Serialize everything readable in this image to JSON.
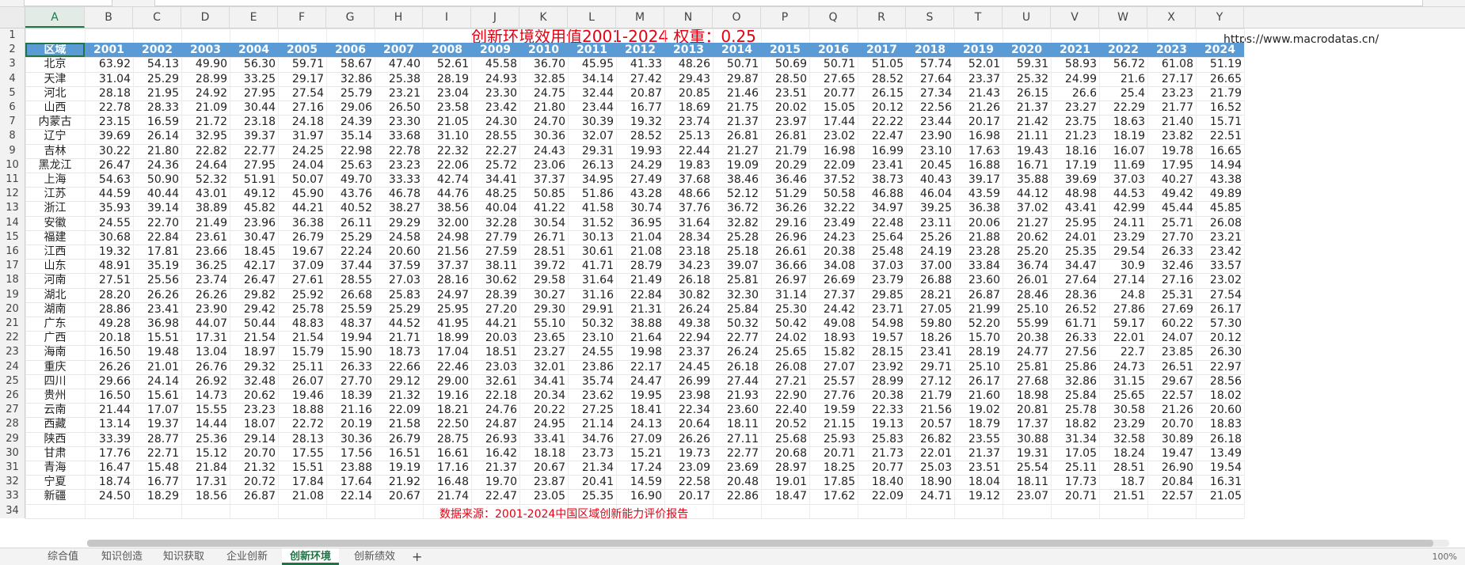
{
  "name_box": "A2",
  "formula_bar": "区域",
  "title": "创新环境效用值2001-2024    权重：0.25",
  "url": "https://www.macrodatas.cn/",
  "footer_note": "数据来源：2001-2024中国区域创新能力评价报告",
  "columns": [
    "A",
    "B",
    "C",
    "D",
    "E",
    "F",
    "G",
    "H",
    "I",
    "J",
    "K",
    "L",
    "M",
    "N",
    "O",
    "P",
    "Q",
    "R",
    "S",
    "T",
    "U",
    "V",
    "W",
    "X",
    "Y"
  ],
  "header_row": [
    "区域",
    "2001",
    "2002",
    "2003",
    "2004",
    "2005",
    "2006",
    "2007",
    "2008",
    "2009",
    "2010",
    "2011",
    "2012",
    "2013",
    "2014",
    "2015",
    "2016",
    "2017",
    "2018",
    "2019",
    "2020",
    "2021",
    "2022",
    "2023",
    "2024"
  ],
  "rows": [
    [
      "北京",
      "63.92",
      "54.13",
      "49.90",
      "56.30",
      "59.71",
      "58.67",
      "47.40",
      "52.61",
      "45.58",
      "36.70",
      "45.95",
      "41.33",
      "48.26",
      "50.71",
      "50.69",
      "50.71",
      "51.05",
      "57.74",
      "52.01",
      "59.31",
      "58.93",
      "56.72",
      "61.08",
      "51.19"
    ],
    [
      "天津",
      "31.04",
      "25.29",
      "28.99",
      "33.25",
      "29.17",
      "32.86",
      "25.38",
      "28.19",
      "24.93",
      "32.85",
      "34.14",
      "27.42",
      "29.43",
      "29.87",
      "28.50",
      "27.65",
      "28.52",
      "27.64",
      "23.37",
      "25.32",
      "24.99",
      "21.6",
      "27.17",
      "26.65"
    ],
    [
      "河北",
      "28.18",
      "21.95",
      "24.92",
      "27.95",
      "27.54",
      "25.79",
      "23.21",
      "23.04",
      "23.30",
      "24.75",
      "32.44",
      "20.87",
      "20.85",
      "21.46",
      "23.51",
      "20.77",
      "26.15",
      "27.34",
      "21.43",
      "26.15",
      "26.6",
      "25.4",
      "23.23",
      "21.79"
    ],
    [
      "山西",
      "22.78",
      "28.33",
      "21.09",
      "30.44",
      "27.16",
      "29.06",
      "26.50",
      "23.58",
      "23.42",
      "21.80",
      "23.44",
      "16.77",
      "18.69",
      "21.75",
      "20.02",
      "15.05",
      "20.12",
      "22.56",
      "21.26",
      "21.37",
      "23.27",
      "22.29",
      "21.77",
      "16.52"
    ],
    [
      "内蒙古",
      "23.15",
      "16.59",
      "21.72",
      "23.18",
      "24.18",
      "24.39",
      "23.30",
      "21.05",
      "24.30",
      "24.70",
      "30.39",
      "19.32",
      "23.74",
      "21.37",
      "23.97",
      "17.44",
      "22.22",
      "23.44",
      "20.17",
      "21.42",
      "23.75",
      "18.63",
      "21.40",
      "15.71"
    ],
    [
      "辽宁",
      "39.69",
      "26.14",
      "32.95",
      "39.37",
      "31.97",
      "35.14",
      "33.68",
      "31.10",
      "28.55",
      "30.36",
      "32.07",
      "28.52",
      "25.13",
      "26.81",
      "26.81",
      "23.02",
      "22.47",
      "23.90",
      "16.98",
      "21.11",
      "21.23",
      "18.19",
      "23.82",
      "22.51"
    ],
    [
      "吉林",
      "30.22",
      "21.80",
      "22.82",
      "22.77",
      "24.25",
      "22.98",
      "22.78",
      "22.32",
      "22.27",
      "24.43",
      "29.31",
      "19.93",
      "22.44",
      "21.27",
      "21.79",
      "16.98",
      "16.99",
      "23.10",
      "17.63",
      "19.43",
      "18.16",
      "16.07",
      "19.78",
      "16.65"
    ],
    [
      "黑龙江",
      "26.47",
      "24.36",
      "24.64",
      "27.95",
      "24.04",
      "25.63",
      "23.23",
      "22.06",
      "25.72",
      "23.06",
      "26.13",
      "24.29",
      "19.83",
      "19.09",
      "20.29",
      "22.09",
      "23.41",
      "20.45",
      "16.88",
      "16.71",
      "17.19",
      "11.69",
      "17.95",
      "14.94"
    ],
    [
      "上海",
      "54.63",
      "50.90",
      "52.32",
      "51.91",
      "50.07",
      "49.70",
      "33.33",
      "42.74",
      "34.41",
      "37.37",
      "34.95",
      "27.49",
      "37.68",
      "38.46",
      "36.46",
      "37.52",
      "38.73",
      "40.43",
      "39.17",
      "35.88",
      "39.69",
      "37.03",
      "40.27",
      "43.38"
    ],
    [
      "江苏",
      "44.59",
      "40.44",
      "43.01",
      "49.12",
      "45.90",
      "43.76",
      "46.78",
      "44.76",
      "48.25",
      "50.85",
      "51.86",
      "43.28",
      "48.66",
      "52.12",
      "51.29",
      "50.58",
      "46.88",
      "46.04",
      "43.59",
      "44.12",
      "48.98",
      "44.53",
      "49.42",
      "49.89"
    ],
    [
      "浙江",
      "35.93",
      "39.14",
      "38.89",
      "45.82",
      "44.21",
      "40.52",
      "38.27",
      "38.56",
      "40.04",
      "41.22",
      "41.58",
      "30.74",
      "37.76",
      "36.72",
      "36.26",
      "32.22",
      "34.97",
      "39.25",
      "36.38",
      "37.02",
      "43.41",
      "42.99",
      "45.44",
      "45.85"
    ],
    [
      "安徽",
      "24.55",
      "22.70",
      "21.49",
      "23.96",
      "36.38",
      "26.11",
      "29.29",
      "32.00",
      "32.28",
      "30.54",
      "31.52",
      "36.95",
      "31.64",
      "32.82",
      "29.16",
      "23.49",
      "22.48",
      "23.11",
      "20.06",
      "21.27",
      "25.95",
      "24.11",
      "25.71",
      "26.08"
    ],
    [
      "福建",
      "30.68",
      "22.84",
      "23.61",
      "30.47",
      "26.79",
      "25.29",
      "24.58",
      "24.98",
      "27.79",
      "26.71",
      "30.13",
      "21.04",
      "28.34",
      "25.28",
      "26.96",
      "24.23",
      "25.64",
      "25.26",
      "21.88",
      "20.62",
      "24.01",
      "23.29",
      "27.70",
      "23.21"
    ],
    [
      "江西",
      "19.32",
      "17.81",
      "23.66",
      "18.45",
      "19.67",
      "22.24",
      "20.60",
      "21.56",
      "27.59",
      "28.51",
      "30.61",
      "21.08",
      "23.18",
      "25.18",
      "26.61",
      "20.38",
      "25.48",
      "24.19",
      "23.28",
      "25.20",
      "25.35",
      "29.54",
      "26.33",
      "23.42"
    ],
    [
      "山东",
      "48.91",
      "35.19",
      "36.25",
      "42.17",
      "37.09",
      "37.44",
      "37.59",
      "37.37",
      "38.11",
      "39.72",
      "41.71",
      "28.79",
      "34.23",
      "39.07",
      "36.66",
      "34.08",
      "37.03",
      "37.00",
      "33.84",
      "36.74",
      "34.47",
      "30.9",
      "32.46",
      "33.57"
    ],
    [
      "河南",
      "27.51",
      "25.56",
      "23.74",
      "26.47",
      "27.61",
      "28.55",
      "27.03",
      "28.16",
      "30.62",
      "29.58",
      "31.64",
      "21.49",
      "26.18",
      "25.81",
      "26.97",
      "26.69",
      "23.79",
      "26.88",
      "23.60",
      "26.01",
      "27.64",
      "27.14",
      "27.16",
      "23.02"
    ],
    [
      "湖北",
      "28.20",
      "26.26",
      "26.26",
      "29.82",
      "25.92",
      "26.68",
      "25.83",
      "24.97",
      "28.39",
      "30.27",
      "31.16",
      "22.84",
      "30.82",
      "32.30",
      "31.14",
      "27.37",
      "29.85",
      "28.21",
      "26.87",
      "28.46",
      "28.36",
      "24.8",
      "25.31",
      "27.54"
    ],
    [
      "湖南",
      "28.86",
      "23.41",
      "23.90",
      "29.42",
      "25.78",
      "25.59",
      "25.29",
      "25.95",
      "27.20",
      "29.30",
      "29.91",
      "21.31",
      "26.24",
      "25.84",
      "25.30",
      "24.42",
      "23.71",
      "27.05",
      "21.99",
      "25.10",
      "26.52",
      "27.86",
      "27.69",
      "26.17"
    ],
    [
      "广东",
      "49.28",
      "36.98",
      "44.07",
      "50.44",
      "48.83",
      "48.37",
      "44.52",
      "41.95",
      "44.21",
      "55.10",
      "50.32",
      "38.88",
      "49.38",
      "50.32",
      "50.42",
      "49.08",
      "54.98",
      "59.80",
      "52.20",
      "55.99",
      "61.71",
      "59.17",
      "60.22",
      "57.30"
    ],
    [
      "广西",
      "20.18",
      "15.51",
      "17.31",
      "21.54",
      "21.54",
      "19.94",
      "21.71",
      "18.99",
      "20.03",
      "23.65",
      "23.10",
      "21.64",
      "22.94",
      "22.77",
      "24.02",
      "18.93",
      "19.57",
      "18.26",
      "15.70",
      "20.38",
      "26.33",
      "22.01",
      "24.07",
      "20.12"
    ],
    [
      "海南",
      "16.50",
      "19.48",
      "13.04",
      "18.97",
      "15.79",
      "15.90",
      "18.73",
      "17.04",
      "18.51",
      "23.27",
      "24.55",
      "19.98",
      "23.37",
      "26.24",
      "25.65",
      "15.82",
      "28.15",
      "23.41",
      "28.19",
      "24.77",
      "27.56",
      "22.7",
      "23.85",
      "26.30"
    ],
    [
      "重庆",
      "26.26",
      "21.01",
      "26.76",
      "29.32",
      "25.11",
      "26.33",
      "22.66",
      "22.46",
      "23.03",
      "32.01",
      "23.86",
      "22.17",
      "24.45",
      "26.18",
      "26.08",
      "27.07",
      "23.92",
      "29.71",
      "25.10",
      "25.81",
      "25.86",
      "24.73",
      "26.51",
      "22.97"
    ],
    [
      "四川",
      "29.66",
      "24.14",
      "26.92",
      "32.48",
      "26.07",
      "27.70",
      "29.12",
      "29.00",
      "32.61",
      "34.41",
      "35.74",
      "24.47",
      "26.99",
      "27.44",
      "27.21",
      "25.57",
      "28.99",
      "27.12",
      "26.17",
      "27.68",
      "32.86",
      "31.15",
      "29.67",
      "28.56"
    ],
    [
      "贵州",
      "16.50",
      "15.61",
      "14.73",
      "20.62",
      "19.46",
      "18.39",
      "21.32",
      "19.16",
      "22.18",
      "20.34",
      "23.62",
      "19.95",
      "23.98",
      "21.93",
      "22.90",
      "27.76",
      "20.38",
      "21.79",
      "21.60",
      "18.98",
      "25.84",
      "25.65",
      "22.57",
      "18.02"
    ],
    [
      "云南",
      "21.44",
      "17.07",
      "15.55",
      "23.23",
      "18.88",
      "21.16",
      "22.09",
      "18.21",
      "24.76",
      "20.22",
      "27.25",
      "18.41",
      "22.34",
      "23.60",
      "22.40",
      "19.59",
      "22.33",
      "21.56",
      "19.02",
      "20.81",
      "25.78",
      "30.58",
      "21.26",
      "20.60"
    ],
    [
      "西藏",
      "13.14",
      "19.37",
      "14.44",
      "18.07",
      "22.72",
      "20.19",
      "21.58",
      "22.50",
      "24.87",
      "24.95",
      "21.14",
      "24.13",
      "20.64",
      "18.11",
      "20.52",
      "21.15",
      "19.13",
      "20.57",
      "18.79",
      "17.37",
      "18.82",
      "23.29",
      "20.70",
      "18.83"
    ],
    [
      "陕西",
      "33.39",
      "28.77",
      "25.36",
      "29.14",
      "28.13",
      "30.36",
      "26.79",
      "28.75",
      "26.93",
      "33.41",
      "34.76",
      "27.09",
      "26.26",
      "27.11",
      "25.68",
      "25.93",
      "25.83",
      "26.82",
      "23.55",
      "30.88",
      "31.34",
      "32.58",
      "30.89",
      "26.18"
    ],
    [
      "甘肃",
      "17.76",
      "22.71",
      "15.12",
      "20.70",
      "17.55",
      "17.56",
      "16.51",
      "16.61",
      "16.42",
      "18.18",
      "23.73",
      "15.21",
      "19.73",
      "22.77",
      "20.68",
      "20.71",
      "21.73",
      "22.01",
      "21.37",
      "19.31",
      "17.05",
      "18.24",
      "19.47",
      "13.49"
    ],
    [
      "青海",
      "16.47",
      "15.48",
      "21.84",
      "21.32",
      "15.51",
      "23.88",
      "19.19",
      "17.16",
      "21.37",
      "20.67",
      "21.34",
      "17.24",
      "23.09",
      "23.69",
      "28.97",
      "18.25",
      "20.77",
      "25.03",
      "23.51",
      "25.54",
      "25.11",
      "28.51",
      "26.90",
      "19.54"
    ],
    [
      "宁夏",
      "18.74",
      "16.77",
      "17.31",
      "20.72",
      "17.84",
      "17.64",
      "21.92",
      "16.48",
      "19.70",
      "23.87",
      "20.41",
      "14.59",
      "22.58",
      "20.48",
      "19.01",
      "17.85",
      "18.40",
      "18.90",
      "18.04",
      "18.11",
      "17.73",
      "18.7",
      "20.84",
      "16.31"
    ],
    [
      "新疆",
      "24.50",
      "18.29",
      "18.56",
      "26.87",
      "21.08",
      "22.14",
      "20.67",
      "21.74",
      "22.47",
      "23.05",
      "25.35",
      "16.90",
      "20.17",
      "22.86",
      "18.47",
      "17.62",
      "22.09",
      "24.71",
      "19.12",
      "23.07",
      "20.71",
      "21.51",
      "22.57",
      "21.05"
    ]
  ],
  "sheet_tabs": [
    "综合值",
    "知识创造",
    "知识获取",
    "企业创新",
    "创新环境",
    "创新绩效"
  ],
  "active_tab": 4,
  "add_tab": "+",
  "zoom": "100%",
  "colors": {
    "header_fill": "#5b9bd5",
    "title_red": "#e60012",
    "excel_green": "#217346"
  }
}
